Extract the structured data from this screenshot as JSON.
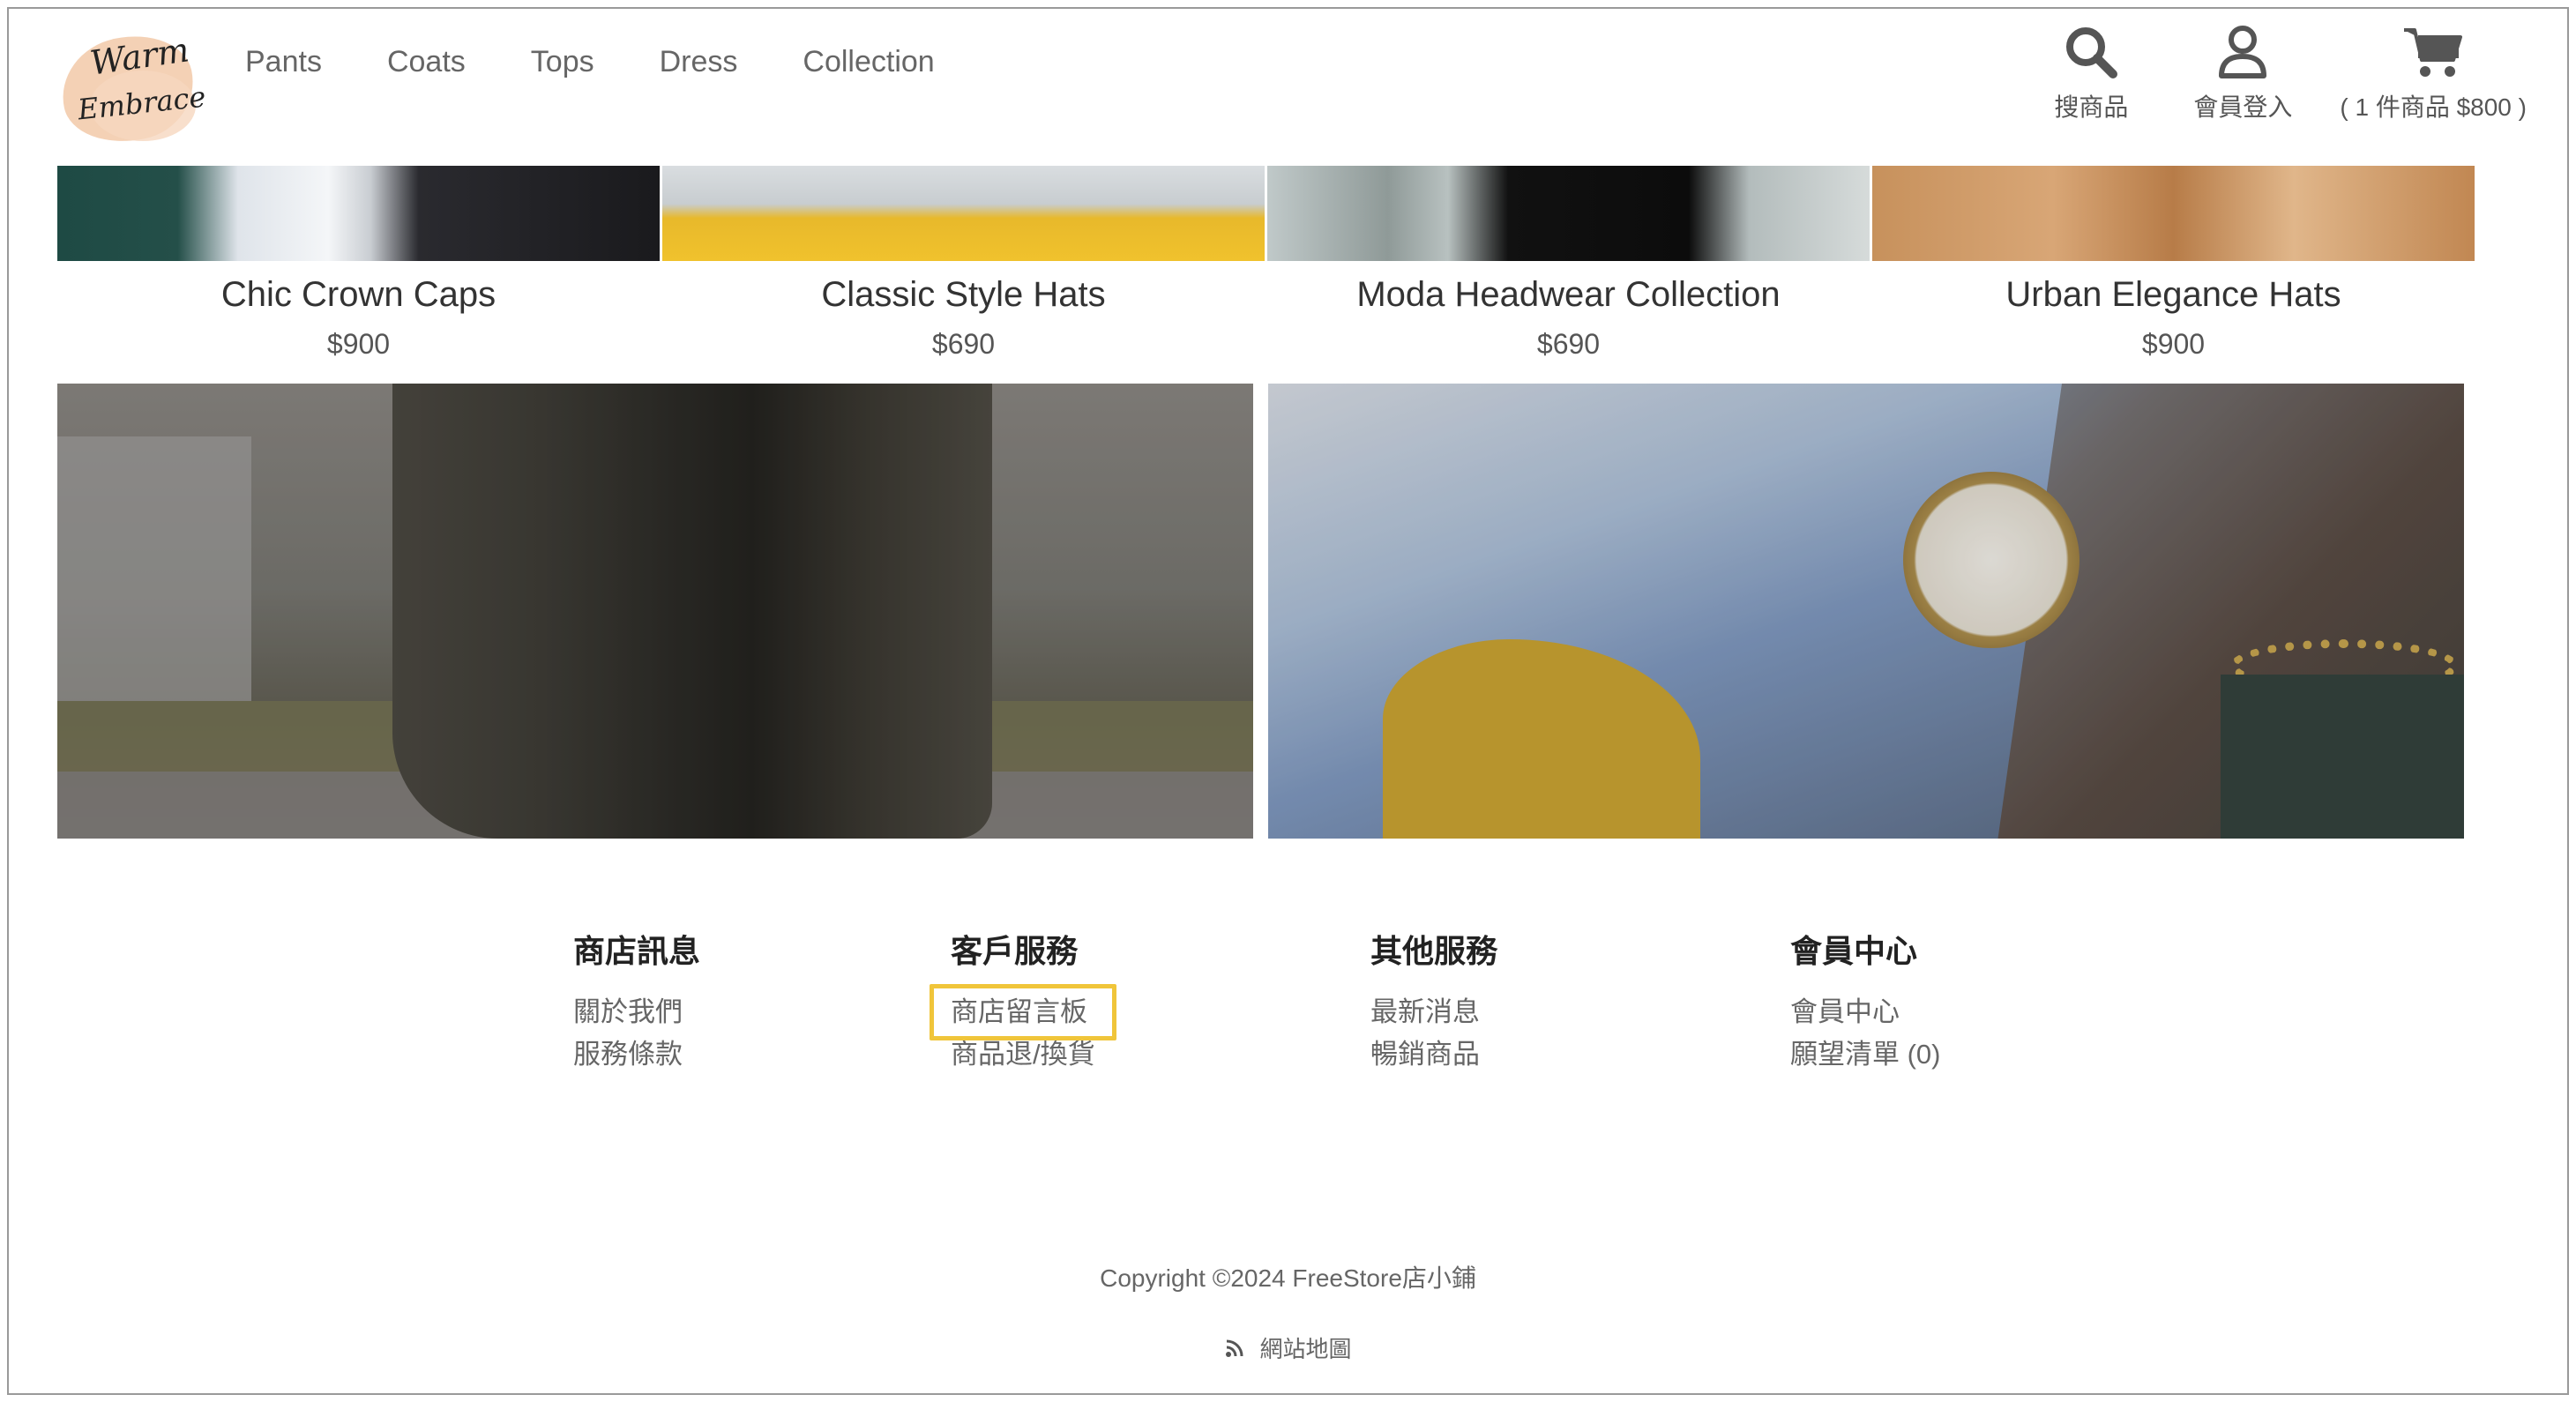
{
  "header": {
    "logo_text_line1": "Warm",
    "logo_text_line2": "Embrace",
    "nav": [
      {
        "label": "Pants"
      },
      {
        "label": "Coats"
      },
      {
        "label": "Tops"
      },
      {
        "label": "Dress"
      },
      {
        "label": "Collection"
      }
    ],
    "search_label": "搜商品",
    "member_label": "會員登入",
    "cart_label": "( 1 件商品 $800 )"
  },
  "products": [
    {
      "name": "Chic Crown Caps",
      "price": "$900"
    },
    {
      "name": "Classic Style Hats",
      "price": "$690"
    },
    {
      "name": "Moda Headwear Collection",
      "price": "$690"
    },
    {
      "name": "Urban Elegance Hats",
      "price": "$900"
    }
  ],
  "footer": {
    "columns": [
      {
        "heading": "商店訊息",
        "links": [
          "關於我們",
          "服務條款"
        ]
      },
      {
        "heading": "客戶服務",
        "links": [
          "商店留言板",
          "商品退/換貨"
        ]
      },
      {
        "heading": "其他服務",
        "links": [
          "最新消息",
          "暢銷商品"
        ]
      },
      {
        "heading": "會員中心",
        "links": [
          "會員中心",
          "願望清單 (0)"
        ]
      }
    ],
    "copyright": "Copyright ©2024 FreeStore店小鋪",
    "sitemap_label": "網站地圖"
  },
  "colors": {
    "highlight": "#f0c53a",
    "nav_text": "#666666",
    "icon": "#555555"
  }
}
